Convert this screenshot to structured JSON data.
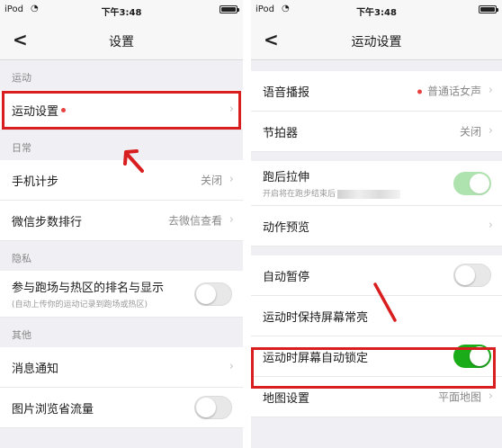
{
  "left": {
    "status": {
      "carrier": "iPod",
      "wifi": "wifi-icon",
      "time": "下午3:48"
    },
    "nav": {
      "back": "<",
      "title": "设置"
    },
    "sections": [
      {
        "header": "运动",
        "rows": [
          {
            "label": "运动设置"
          }
        ]
      },
      {
        "header": "日常",
        "rows": [
          {
            "label": "手机计步",
            "value": "关闭"
          },
          {
            "label": "微信步数排行",
            "value": "去微信查看"
          }
        ]
      },
      {
        "header": "隐私",
        "rows": [
          {
            "label": "参与跑场与热区的排名与显示",
            "sub": "(自动上传你的运动记录到跑场或热区)",
            "toggle": false
          }
        ]
      },
      {
        "header": "其他",
        "rows": [
          {
            "label": "消息通知"
          },
          {
            "label": "图片浏览省流量",
            "toggle": false
          }
        ]
      }
    ]
  },
  "right": {
    "status": {
      "carrier": "iPod",
      "wifi": "wifi-icon",
      "time": "下午3:48"
    },
    "nav": {
      "back": "<",
      "title": "运动设置"
    },
    "rows_group1": [
      {
        "label": "语音播报",
        "value": "普通话女声"
      },
      {
        "label": "节拍器",
        "value": "关闭"
      }
    ],
    "rows_group2": [
      {
        "label": "跑后拉伸",
        "sub": "开启将在跑步结束后"
      },
      {
        "label": "动作预览"
      }
    ],
    "rows_group3": [
      {
        "label": "自动暂停",
        "toggle": false
      },
      {
        "label": "运动时保持屏幕常亮"
      },
      {
        "label": "运动时屏幕自动锁定",
        "toggle": true
      },
      {
        "label": "地图设置",
        "value": "平面地图"
      }
    ]
  },
  "colors": {
    "accent_toggle": "#1aad19",
    "highlight": "#d81e1e",
    "badge_dot": "#e64340"
  }
}
